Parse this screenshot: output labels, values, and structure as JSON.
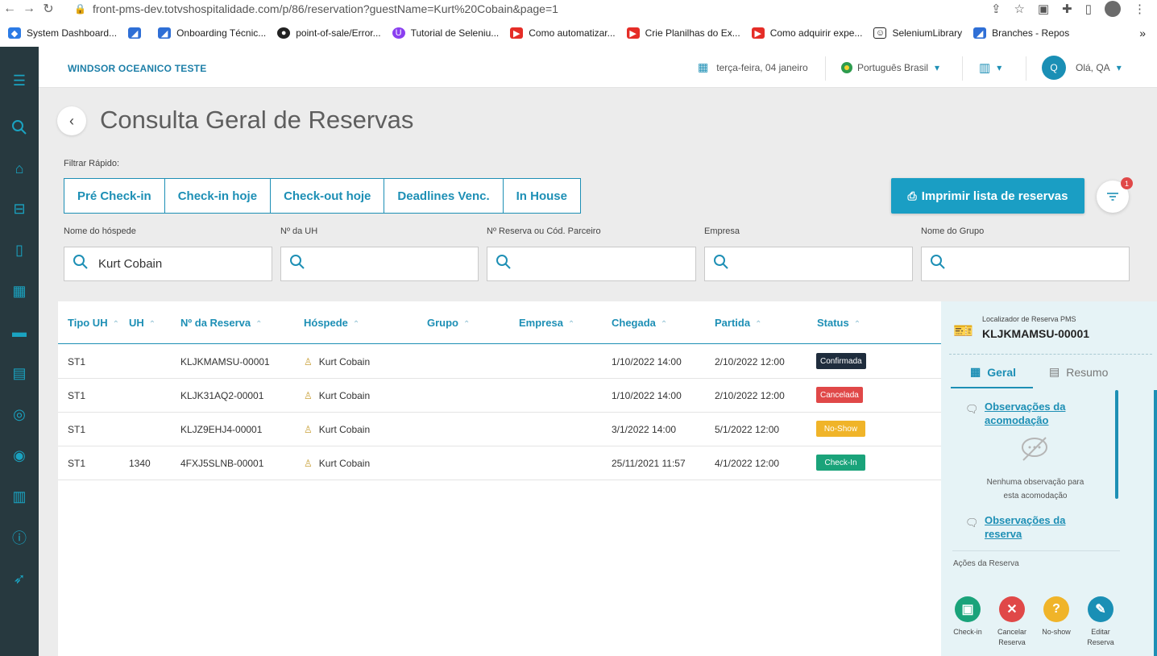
{
  "browser": {
    "url": "front-pms-dev.totvshospitalidade.com/p/86/reservation?guestName=Kurt%20Cobain&page=1",
    "bookmarks": [
      {
        "label": "System Dashboard...",
        "icon": "jira-icon"
      },
      {
        "label": "",
        "icon": "azure-devops-icon"
      },
      {
        "label": "Onboarding Técnic...",
        "icon": "azure-devops-icon"
      },
      {
        "label": "point-of-sale/Error...",
        "icon": "github-icon"
      },
      {
        "label": "Tutorial de Seleniu...",
        "icon": "udemy-icon"
      },
      {
        "label": "Como automatizar...",
        "icon": "youtube-icon"
      },
      {
        "label": "Crie Planilhas do Ex...",
        "icon": "youtube-icon"
      },
      {
        "label": "Como adquirir expe...",
        "icon": "youtube-icon"
      },
      {
        "label": "SeleniumLibrary",
        "icon": "selenium-icon"
      },
      {
        "label": "Branches - Repos",
        "icon": "azure-devops-icon"
      }
    ],
    "more": "»"
  },
  "topbar": {
    "hotel_name": "WINDSOR OCEANICO TESTE",
    "date": "terça-feira, 04 janeiro",
    "language": "Português Brasil",
    "avatar_initial": "Q",
    "greeting": "Olá, QA"
  },
  "page": {
    "title": "Consulta Geral de Reservas",
    "quick_filter_label": "Filtrar Rápido:",
    "quick_filters": [
      "Pré Check-in",
      "Check-in hoje",
      "Check-out hoje",
      "Deadlines Venc.",
      "In House"
    ],
    "print_button": "Imprimir lista de reservas",
    "filter_badge": "1"
  },
  "filters": {
    "guest_label": "Nome do hóspede",
    "guest_value": "Kurt Cobain",
    "uh_label": "Nº da UH",
    "uh_value": "",
    "reservation_label": "Nº Reserva ou Cód. Parceiro",
    "reservation_value": "",
    "company_label": "Empresa",
    "company_value": "",
    "group_label": "Nome do Grupo",
    "group_value": ""
  },
  "table": {
    "headers": [
      "Tipo UH",
      "UH",
      "Nº da Reserva",
      "Hóspede",
      "Grupo",
      "Empresa",
      "Chegada",
      "Partida",
      "Status"
    ],
    "rows": [
      {
        "tipo": "ST1",
        "uh": "",
        "reserva": "KLJKMAMSU-00001",
        "hospede": "Kurt Cobain",
        "grupo": "",
        "empresa": "",
        "chegada": "1/10/2022 14:00",
        "partida": "2/10/2022 12:00",
        "status": "Confirmada"
      },
      {
        "tipo": "ST1",
        "uh": "",
        "reserva": "KLJK31AQ2-00001",
        "hospede": "Kurt Cobain",
        "grupo": "",
        "empresa": "",
        "chegada": "1/10/2022 14:00",
        "partida": "2/10/2022 12:00",
        "status": "Cancelada"
      },
      {
        "tipo": "ST1",
        "uh": "",
        "reserva": "KLJZ9EHJ4-00001",
        "hospede": "Kurt Cobain",
        "grupo": "",
        "empresa": "",
        "chegada": "3/1/2022 14:00",
        "partida": "5/1/2022 12:00",
        "status": "No-Show"
      },
      {
        "tipo": "ST1",
        "uh": "1340",
        "reserva": "4FXJ5SLNB-00001",
        "hospede": "Kurt Cobain",
        "grupo": "",
        "empresa": "",
        "chegada": "25/11/2021 11:57",
        "partida": "4/1/2022 12:00",
        "status": "Check-In"
      }
    ]
  },
  "status_colors": {
    "Confirmada": "#1f2d3d",
    "Cancelada": "#e04848",
    "No-Show": "#f0b429",
    "Check-In": "#1aa37a"
  },
  "panel": {
    "caption": "Localizador de Reserva PMS",
    "code": "KLJKMAMSU-00001",
    "tab_general": "Geral",
    "tab_summary": "Resumo",
    "obs_room": "Observações da acomodação",
    "empty_text": "Nenhuma observação para esta acomodação",
    "obs_reservation": "Observações da reserva",
    "actions_label": "Ações da Reserva",
    "actions": [
      {
        "label": "Check-in",
        "color": "#1aa37a"
      },
      {
        "label": "Cancelar Reserva",
        "color": "#e04848"
      },
      {
        "label": "No-show",
        "color": "#f0b429"
      },
      {
        "label": "Editar Reserva",
        "color": "#1a8fb5"
      }
    ]
  }
}
